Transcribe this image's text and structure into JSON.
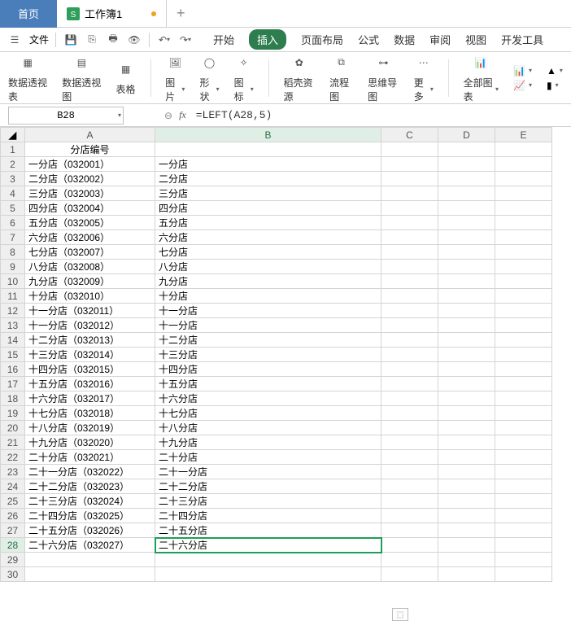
{
  "titlebar": {
    "home": "首页",
    "file_tab": "工作簿1",
    "new_tab": "+"
  },
  "qat": {
    "file_label": "文件"
  },
  "menu": {
    "start": "开始",
    "insert": "插入",
    "page_layout": "页面布局",
    "formulas": "公式",
    "data": "数据",
    "review": "审阅",
    "view": "视图",
    "developer": "开发工具"
  },
  "ribbon": {
    "pivot_table": "数据透视表",
    "pivot_chart": "数据透视图",
    "table": "表格",
    "picture": "图片",
    "shapes": "形状",
    "icons": "图标",
    "assets": "稻壳资源",
    "flowchart": "流程图",
    "mindmap": "思维导图",
    "more": "更多",
    "all_charts": "全部图表"
  },
  "namebox": "B28",
  "formula": "=LEFT(A28,5)",
  "fx": "fx",
  "col_headers": [
    "A",
    "B",
    "C",
    "D",
    "E"
  ],
  "header_row": {
    "a": "分店编号"
  },
  "rows": [
    {
      "a": "一分店（032001）",
      "b": "一分店"
    },
    {
      "a": "二分店（032002）",
      "b": "二分店"
    },
    {
      "a": "三分店（032003）",
      "b": "三分店"
    },
    {
      "a": "四分店（032004）",
      "b": "四分店"
    },
    {
      "a": "五分店（032005）",
      "b": "五分店"
    },
    {
      "a": "六分店（032006）",
      "b": "六分店"
    },
    {
      "a": "七分店（032007）",
      "b": "七分店"
    },
    {
      "a": "八分店（032008）",
      "b": "八分店"
    },
    {
      "a": "九分店（032009）",
      "b": "九分店"
    },
    {
      "a": "十分店（032010）",
      "b": "十分店"
    },
    {
      "a": "十一分店（032011）",
      "b": "十一分店"
    },
    {
      "a": "十一分店（032012）",
      "b": "十一分店"
    },
    {
      "a": "十二分店（032013）",
      "b": "十二分店"
    },
    {
      "a": "十三分店（032014）",
      "b": "十三分店"
    },
    {
      "a": "十四分店（032015）",
      "b": "十四分店"
    },
    {
      "a": "十五分店（032016）",
      "b": "十五分店"
    },
    {
      "a": "十六分店（032017）",
      "b": "十六分店"
    },
    {
      "a": "十七分店（032018）",
      "b": "十七分店"
    },
    {
      "a": "十八分店（032019）",
      "b": "十八分店"
    },
    {
      "a": "十九分店（032020）",
      "b": "十九分店"
    },
    {
      "a": "二十分店（032021）",
      "b": "二十分店"
    },
    {
      "a": "二十一分店（032022）",
      "b": "二十一分店"
    },
    {
      "a": "二十二分店（032023）",
      "b": "二十二分店"
    },
    {
      "a": "二十三分店（032024）",
      "b": "二十三分店"
    },
    {
      "a": "二十四分店（032025）",
      "b": "二十四分店"
    },
    {
      "a": "二十五分店（032026）",
      "b": "二十五分店"
    },
    {
      "a": "二十六分店（032027）",
      "b": "二十六分店"
    }
  ],
  "autofill_hint": "⿴"
}
